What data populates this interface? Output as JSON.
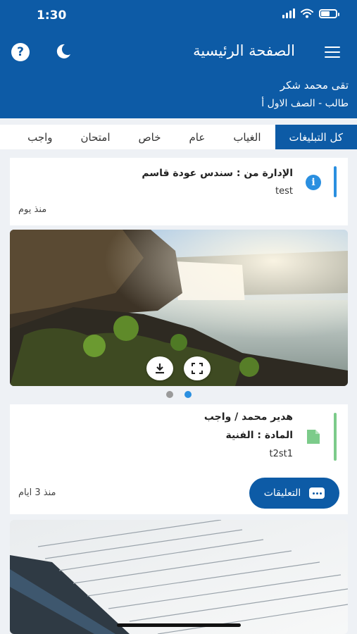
{
  "status_bar": {
    "time": "1:30"
  },
  "header": {
    "title": "الصفحة الرئيسية",
    "help_icon_text": "?",
    "user_name": "تقى محمد شكر",
    "user_class": "طالب - الصف الاول أ"
  },
  "tabs": [
    {
      "label": "كل التبليغات",
      "active": true
    },
    {
      "label": "الغياب"
    },
    {
      "label": "عام"
    },
    {
      "label": "خاص"
    },
    {
      "label": "امتحان"
    },
    {
      "label": "واجب"
    }
  ],
  "announcement": {
    "title": "الإدارة من : سندس عودة قاسم",
    "body": "test",
    "time": "منذ يوم",
    "icon": "info-icon",
    "icon_text": "i"
  },
  "gallery": {
    "slides": 2,
    "active_slide": 2
  },
  "homework": {
    "title": "هدير محمد / واجب",
    "subject": "المادة : الفنية",
    "body": "t2st1",
    "time": "منذ 3 ايام",
    "comments_label": "التعليقات"
  },
  "colors": {
    "primary": "#0d5ba6",
    "info": "#2a8fe0",
    "homework": "#7ccb8a",
    "background": "#eef1f5"
  }
}
